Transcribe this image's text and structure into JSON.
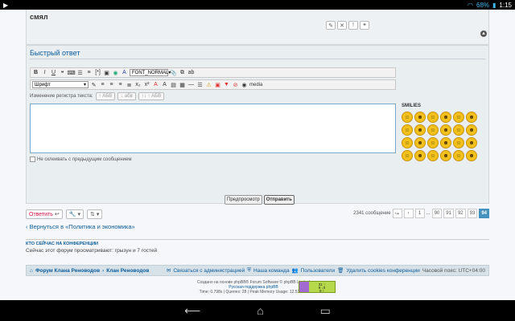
{
  "statusbar": {
    "battery": "68%",
    "time": "1:15"
  },
  "post": {
    "title": "смял"
  },
  "quick_reply": {
    "heading": "Быстрый ответ",
    "toolbar1": {
      "font_size": "FONT_NORMAL"
    },
    "toolbar2": {
      "font": "Шрифт",
      "media": "media"
    },
    "case_change": {
      "label": "Изменение регистра текста:",
      "btn_upper": "↑ АБВ",
      "btn_lower": "↓ абв",
      "btn_toggle": "↑↓ ↑ АБВ"
    },
    "no_merge": "Не склеивать с предыдущим сообщением",
    "smilies_label": "SMILIES",
    "preview_label": "Предпросмотр",
    "submit_label": "Отправить"
  },
  "actionbar": {
    "reply_label": "Ответить",
    "post_count": "2341 сообщение",
    "pages": [
      "1",
      "...",
      "90",
      "91",
      "92",
      "93",
      "94"
    ],
    "active_page": "94"
  },
  "back_link": "Вернуться в «Политика и экономика»",
  "who_online": {
    "heading": "КТО СЕЙЧАС НА КОНФЕРЕНЦИИ",
    "text": "Сейчас этот форум просматривают: грызун и 7 гостей"
  },
  "footer_nav": {
    "crumb1": "Форум Клана Реноводов",
    "crumb2": "Клан Реноводов",
    "contact": "Связаться с администрацией",
    "team": "Наша команда",
    "users": "Пользователи",
    "cookies": "Удалить cookies конференции",
    "timezone": "Часовой пояс: UTC+04:00"
  },
  "copyright": {
    "line1": "Создано на основе phpBB® Forum Software © phpBB Limited",
    "line2": "Русская поддержка phpBB",
    "line3": "Time: 0.798s | Queries: 28 | Peak Memory Usage: 12.53 MiB"
  },
  "counter": {
    "line1": "31 ↑",
    "line2": "9 ↓0",
    "line3": "9 ↑"
  },
  "colors": {
    "accent": "#0b5c9a",
    "reply": "#d31141",
    "active_page": "#4692bf"
  }
}
